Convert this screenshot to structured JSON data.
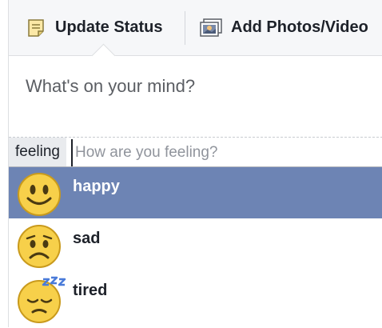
{
  "tabs": {
    "update_status": "Update Status",
    "add_photos": "Add Photos/Video"
  },
  "composer": {
    "placeholder": "What's on your mind?"
  },
  "feeling": {
    "tag": "feeling",
    "input_value": "",
    "input_placeholder": "How are you feeling?"
  },
  "menu": {
    "items": [
      {
        "label": "happy",
        "icon": "happy-face-icon",
        "selected": true
      },
      {
        "label": "sad",
        "icon": "sad-face-icon",
        "selected": false
      },
      {
        "label": "tired",
        "icon": "tired-face-icon",
        "selected": false
      }
    ]
  },
  "colors": {
    "selected_bg": "#6d84b4",
    "tab_bar_bg": "#f6f7f9",
    "emoji_yellow": "#f7d04a",
    "zzz_blue": "#4a7bd9"
  }
}
